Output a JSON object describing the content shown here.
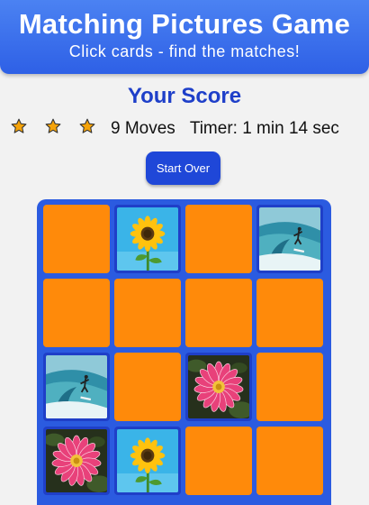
{
  "header": {
    "title": "Matching Pictures Game",
    "subtitle": "Click cards - find the matches!"
  },
  "score": {
    "title": "Your Score",
    "stars": 3,
    "moves": "9 Moves",
    "timer": "Timer: 1 min 14 sec"
  },
  "restart_label": "Start Over",
  "colors": {
    "header_bg": "#3b6fec",
    "card_back": "#ff8a0a",
    "board_bg": "#2b5be0",
    "accent": "#1e3fc9",
    "star": "#f5a30a"
  },
  "board": {
    "rows": 4,
    "cols": 4,
    "cards": [
      {
        "state": "hidden"
      },
      {
        "state": "open",
        "image": "sunflower"
      },
      {
        "state": "hidden"
      },
      {
        "state": "open",
        "image": "surfer"
      },
      {
        "state": "hidden"
      },
      {
        "state": "hidden"
      },
      {
        "state": "hidden"
      },
      {
        "state": "hidden"
      },
      {
        "state": "open",
        "image": "surfer"
      },
      {
        "state": "hidden"
      },
      {
        "state": "open",
        "image": "pink-flower"
      },
      {
        "state": "hidden"
      },
      {
        "state": "open",
        "image": "pink-flower"
      },
      {
        "state": "open",
        "image": "sunflower"
      },
      {
        "state": "hidden"
      },
      {
        "state": "hidden"
      }
    ]
  }
}
